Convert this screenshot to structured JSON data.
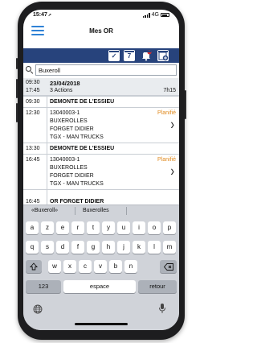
{
  "status_bar": {
    "time": "15:47",
    "network": "4G"
  },
  "navbar": {
    "title": "Mes OR",
    "menu_icon": "hamburger-menu-icon"
  },
  "toolbar": {
    "icons": [
      "calendar-check-icon",
      "calendar-7-icon",
      "notification-alert-icon",
      "add-document-icon"
    ],
    "calendar_day_label": "7",
    "colors": {
      "toolbar_bg": "#27437c",
      "accent": "#2f82d6",
      "planned": "#e08a1e"
    }
  },
  "search": {
    "value": "Buxeroll",
    "icon": "search-icon"
  },
  "list": {
    "day": {
      "start": "09:30",
      "end": "17:45",
      "date": "23/04/2018",
      "actions": "3 Actions",
      "duration": "7h15"
    },
    "items": [
      {
        "time": "09:30",
        "title": "DEMONTE DE L'ESSIEU"
      },
      {
        "time": "12:30",
        "ref": "13040003-1",
        "line1": "BUXEROLLES",
        "line2": "FORGET DIDIER",
        "line3": "TGX - MAN TRUCKS",
        "status": "Planifié"
      },
      {
        "time": "13:30",
        "title": "DEMONTE DE L'ESSIEU"
      },
      {
        "time": "16:45",
        "ref": "13040003-1",
        "line1": "BUXEROLLES",
        "line2": "FORGET DIDIER",
        "line3": "TGX - MAN TRUCKS",
        "status": "Planifié"
      },
      {
        "time": "16:45",
        "title": "OR FORGET DIDIER"
      }
    ]
  },
  "suggestions": [
    "«Buxeroll»",
    "Buxerolles",
    ""
  ],
  "keyboard": {
    "row1": [
      "a",
      "z",
      "e",
      "r",
      "t",
      "y",
      "u",
      "i",
      "o",
      "p"
    ],
    "row2": [
      "q",
      "s",
      "d",
      "f",
      "g",
      "h",
      "j",
      "k",
      "l",
      "m"
    ],
    "row3": [
      "w",
      "x",
      "c",
      "v",
      "b",
      "n"
    ],
    "numbers_key": "123",
    "space_key": "espace",
    "return_key": "retour",
    "shift_icon": "shift-icon",
    "delete_icon": "backspace-icon",
    "globe_icon": "globe-icon",
    "mic_icon": "microphone-icon"
  }
}
